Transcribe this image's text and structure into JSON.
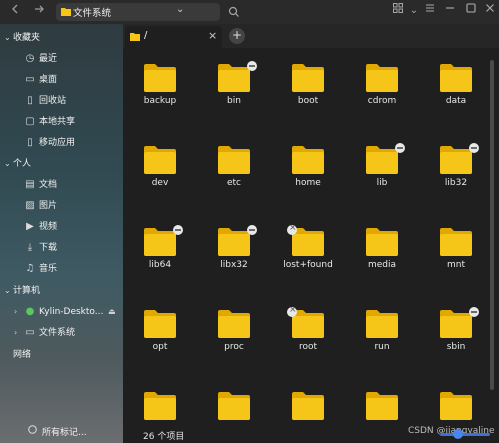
{
  "toolbar": {
    "back_icon": "arrow-left-icon",
    "forward_icon": "arrow-right-icon",
    "location": "文件系统",
    "view_icon": "grid-view-icon",
    "sort_icon": "sort-icon",
    "menu_icon": "menu-icon",
    "minimize_icon": "minimize-icon",
    "maximize_icon": "maximize-icon",
    "close_icon": "close-icon"
  },
  "sidebar": {
    "sections": {
      "favorites": "收藏夹",
      "personal": "个人",
      "computer": "计算机",
      "network": "网络"
    },
    "favorites": [
      "最近",
      "桌面",
      "回收站",
      "本地共享",
      "移动应用"
    ],
    "personal": [
      "文档",
      "图片",
      "视频",
      "下载",
      "音乐"
    ],
    "computer": [
      "Kylin-Deskto...",
      "文件系统"
    ],
    "footer": "所有标记..."
  },
  "tabs": [
    {
      "label": "/"
    }
  ],
  "folders": [
    {
      "name": "backup",
      "badge": ""
    },
    {
      "name": "bin",
      "badge": "link"
    },
    {
      "name": "boot",
      "badge": ""
    },
    {
      "name": "cdrom",
      "badge": ""
    },
    {
      "name": "data",
      "badge": ""
    },
    {
      "name": "dev",
      "badge": ""
    },
    {
      "name": "etc",
      "badge": ""
    },
    {
      "name": "home",
      "badge": ""
    },
    {
      "name": "lib",
      "badge": "link"
    },
    {
      "name": "lib32",
      "badge": "link"
    },
    {
      "name": "lib64",
      "badge": "link"
    },
    {
      "name": "libx32",
      "badge": "link"
    },
    {
      "name": "lost+found",
      "badge": "lock"
    },
    {
      "name": "media",
      "badge": ""
    },
    {
      "name": "mnt",
      "badge": ""
    },
    {
      "name": "opt",
      "badge": ""
    },
    {
      "name": "proc",
      "badge": ""
    },
    {
      "name": "root",
      "badge": "lock"
    },
    {
      "name": "run",
      "badge": ""
    },
    {
      "name": "sbin",
      "badge": "link"
    },
    {
      "name": "",
      "badge": ""
    },
    {
      "name": "",
      "badge": ""
    },
    {
      "name": "",
      "badge": ""
    },
    {
      "name": "",
      "badge": ""
    },
    {
      "name": "",
      "badge": ""
    }
  ],
  "status": {
    "item_count": "26 个项目",
    "watermark": "CSDN @jiangyaline"
  },
  "colors": {
    "folder": "#f5c518",
    "folder_tab": "#e0a800",
    "accent": "#3d6fd6"
  }
}
